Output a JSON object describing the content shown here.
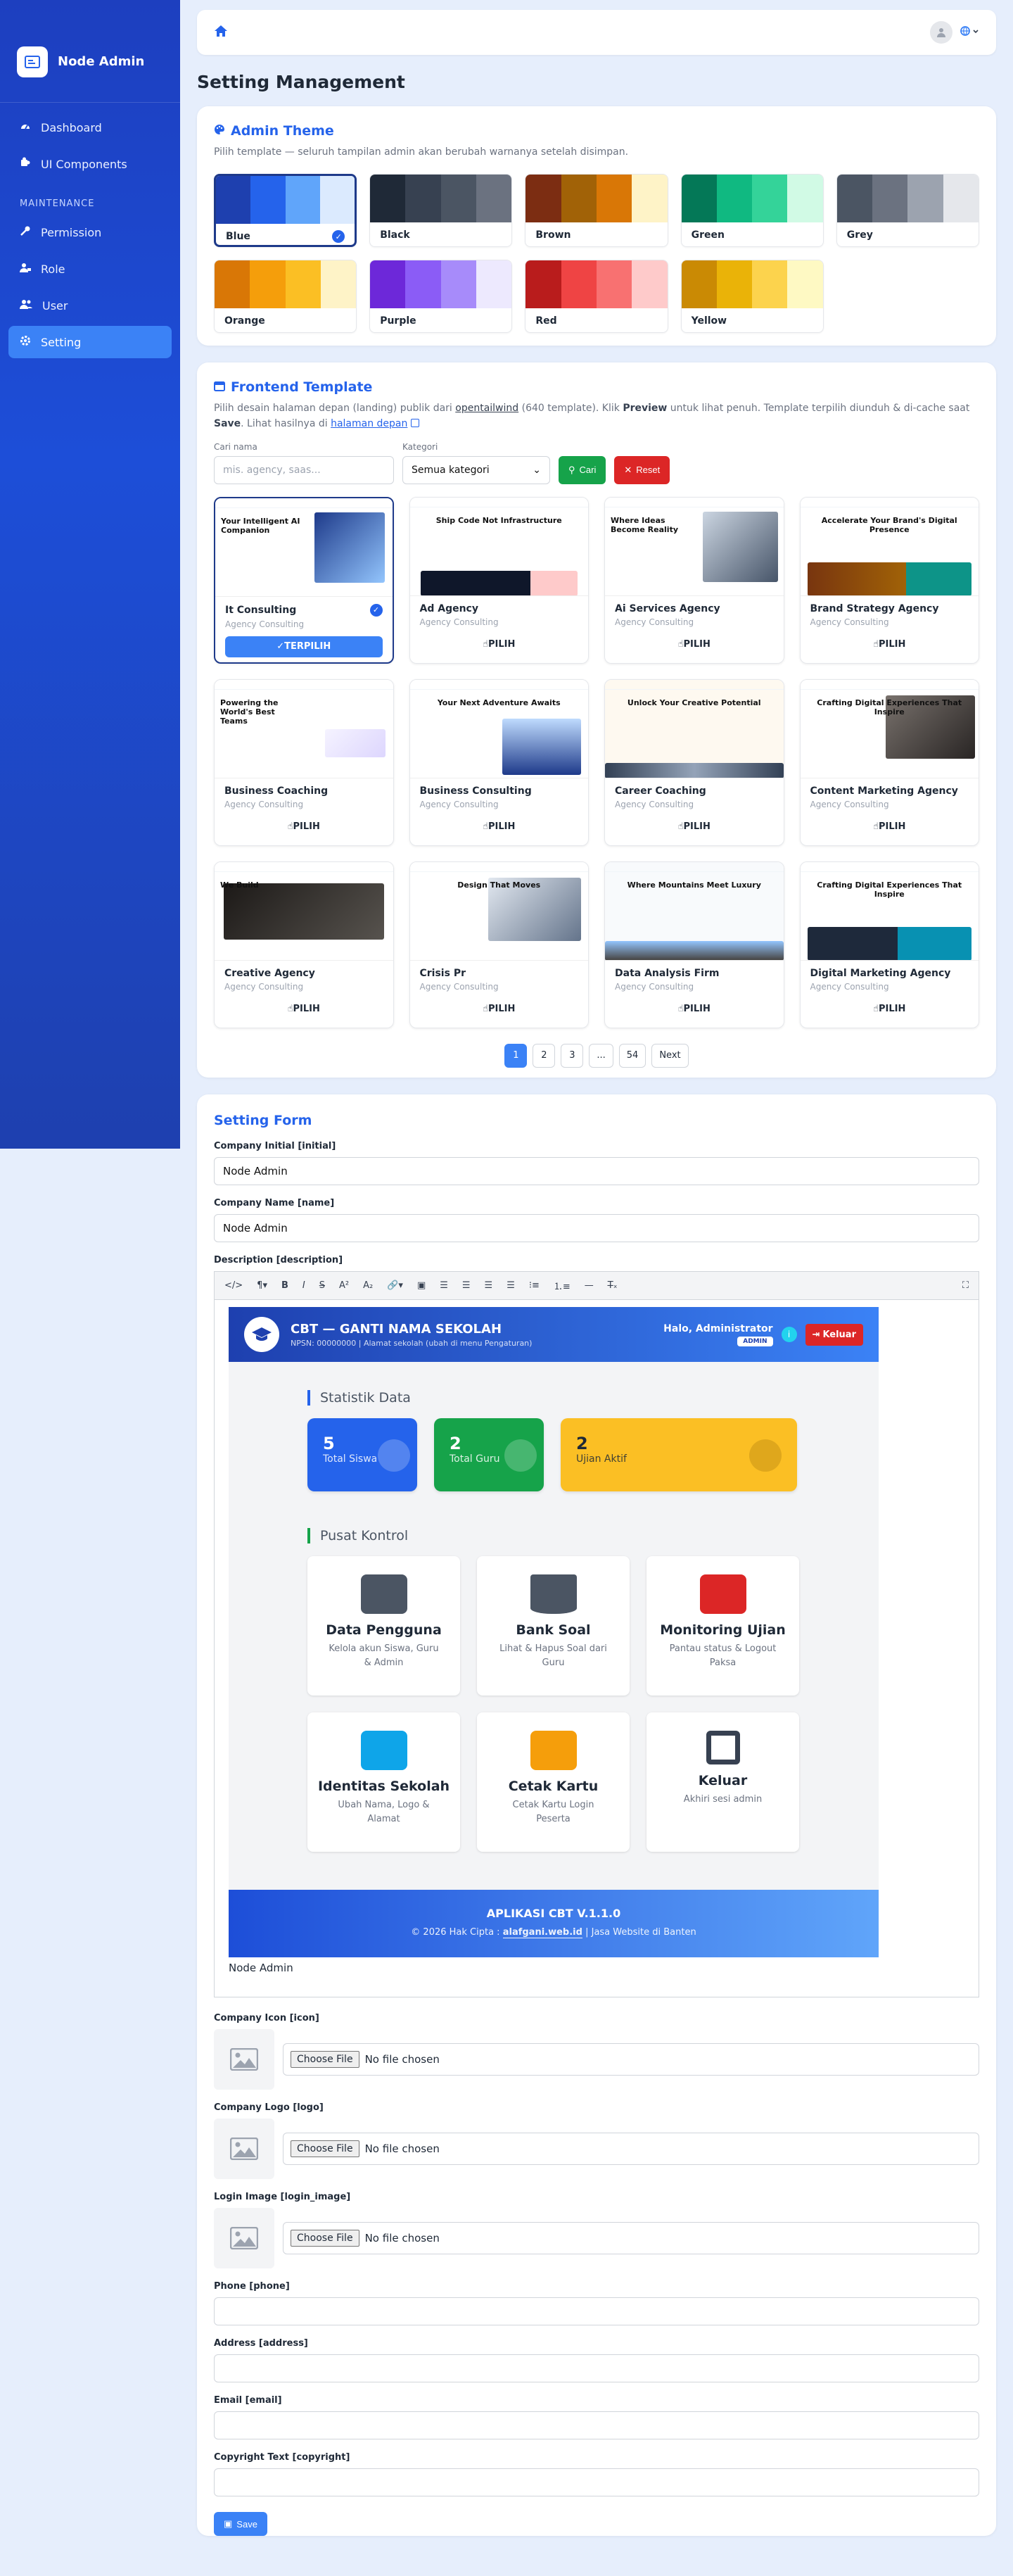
{
  "sidebar": {
    "brand": "Node Admin",
    "items": [
      {
        "label": "Dashboard",
        "icon": "gauge-icon"
      },
      {
        "label": "UI Components",
        "icon": "puzzle-icon"
      }
    ],
    "section_heading": "MAINTENANCE",
    "maintenance_items": [
      {
        "label": "Permission",
        "icon": "key-icon"
      },
      {
        "label": "Role",
        "icon": "user-tag-icon"
      },
      {
        "label": "User",
        "icon": "users-icon"
      },
      {
        "label": "Setting",
        "icon": "gear-icon",
        "active": true
      }
    ]
  },
  "page_title": "Setting Management",
  "theme_section": {
    "title": "Admin Theme",
    "subtitle": "Pilih template — seluruh tampilan admin akan berubah warnanya setelah disimpan.",
    "themes": [
      {
        "name": "Blue",
        "colors": [
          "#1e40af",
          "#2563eb",
          "#60a5fa",
          "#dbeafe"
        ],
        "selected": true
      },
      {
        "name": "Black",
        "colors": [
          "#1f2937",
          "#374151",
          "#4b5563",
          "#6b7280"
        ]
      },
      {
        "name": "Brown",
        "colors": [
          "#7c2d12",
          "#a16207",
          "#d97706",
          "#fef3c7"
        ]
      },
      {
        "name": "Green",
        "colors": [
          "#047857",
          "#10b981",
          "#34d399",
          "#d1fae5"
        ]
      },
      {
        "name": "Grey",
        "colors": [
          "#4b5563",
          "#6b7280",
          "#9ca3af",
          "#e5e7eb"
        ]
      },
      {
        "name": "Orange",
        "colors": [
          "#d97706",
          "#f59e0b",
          "#fbbf24",
          "#fef3c7"
        ]
      },
      {
        "name": "Purple",
        "colors": [
          "#6d28d9",
          "#8b5cf6",
          "#a78bfa",
          "#ede9fe"
        ]
      },
      {
        "name": "Red",
        "colors": [
          "#b91c1c",
          "#ef4444",
          "#f87171",
          "#fecaca"
        ]
      },
      {
        "name": "Yellow",
        "colors": [
          "#ca8a04",
          "#eab308",
          "#fcd34d",
          "#fef9c3"
        ]
      }
    ]
  },
  "frontend_section": {
    "title": "Frontend Template",
    "desc_1": "Pilih desain halaman depan (landing) publik dari ",
    "desc_link": "opentailwind",
    "desc_2": " (640 template). Klik ",
    "desc_preview": "Preview",
    "desc_3": " untuk lihat penuh. Template terpilih diunduh & di-cache saat ",
    "desc_save": "Save",
    "desc_4": ". Lihat hasilnya di ",
    "desc_link2": "halaman depan",
    "search_label": "Cari nama",
    "search_placeholder": "mis. agency, saas...",
    "category_label": "Kategori",
    "category_value": "Semua kategori",
    "search_button": "Cari",
    "reset_button": "Reset",
    "pick_label": "PILIH",
    "picked_label": "TERPILIH",
    "templates": [
      {
        "name": "It Consulting",
        "category": "Agency Consulting",
        "selected": true,
        "headline": "Your Intelligent AI Companion"
      },
      {
        "name": "Ad Agency",
        "category": "Agency Consulting",
        "headline": "Ship Code Not Infrastructure"
      },
      {
        "name": "Ai Services Agency",
        "category": "Agency Consulting",
        "headline": "Where Ideas Become Reality"
      },
      {
        "name": "Brand Strategy Agency",
        "category": "Agency Consulting",
        "headline": "Accelerate Your Brand's Digital Presence"
      },
      {
        "name": "Business Coaching",
        "category": "Agency Consulting",
        "headline": "Powering the World's Best Teams"
      },
      {
        "name": "Business Consulting",
        "category": "Agency Consulting",
        "headline": "Your Next Adventure Awaits"
      },
      {
        "name": "Career Coaching",
        "category": "Agency Consulting",
        "headline": "Unlock Your Creative Potential"
      },
      {
        "name": "Content Marketing Agency",
        "category": "Agency Consulting",
        "headline": "Crafting Digital Experiences That Inspire"
      },
      {
        "name": "Creative Agency",
        "category": "Agency Consulting",
        "headline": "We Build"
      },
      {
        "name": "Crisis Pr",
        "category": "Agency Consulting",
        "headline": "Design That Moves"
      },
      {
        "name": "Data Analysis Firm",
        "category": "Agency Consulting",
        "headline": "Where Mountains Meet Luxury"
      },
      {
        "name": "Digital Marketing Agency",
        "category": "Agency Consulting",
        "headline": "Crafting Digital Experiences That Inspire"
      }
    ],
    "pagination": {
      "pages": [
        "1",
        "2",
        "3",
        "...",
        "54"
      ],
      "current": "1",
      "next": "Next"
    }
  },
  "setting_form": {
    "title": "Setting Form",
    "company_initial_label": "Company Initial [initial]",
    "company_initial_value": "Node Admin",
    "company_name_label": "Company Name [name]",
    "company_name_value": "Node Admin",
    "description_label": "Description [description]",
    "editor_text_below": "Node Admin",
    "icon_label": "Company Icon [icon]",
    "logo_label": "Company Logo [logo]",
    "login_image_label": "Login Image [login_image]",
    "choose_file": "Choose File",
    "no_file": "No file chosen",
    "phone_label": "Phone [phone]",
    "address_label": "Address [address]",
    "email_label": "Email [email]",
    "copyright_label": "Copyright Text [copyright]",
    "save_button": "Save"
  },
  "cbt_preview": {
    "title": "CBT — GANTI NAMA SEKOLAH",
    "subtitle": "NPSN: 00000000 | Alamat sekolah (ubah di menu Pengaturan)",
    "greeting": "Halo, Administrator",
    "role_badge": "ADMIN",
    "logout": "Keluar",
    "stats_heading": "Statistik Data",
    "stats": [
      {
        "value": "5",
        "label": "Total Siswa",
        "color": "#2563eb"
      },
      {
        "value": "2",
        "label": "Total Guru",
        "color": "#16a34a"
      },
      {
        "value": "2",
        "label": "Ujian Aktif",
        "color": "#fbbf24"
      }
    ],
    "control_heading": "Pusat Kontrol",
    "controls": [
      {
        "title": "Data Pengguna",
        "desc": "Kelola akun Siswa, Guru & Admin",
        "icon": "users-cog-icon"
      },
      {
        "title": "Bank Soal",
        "desc": "Lihat & Hapus Soal dari Guru",
        "icon": "book-icon"
      },
      {
        "title": "Monitoring Ujian",
        "desc": "Pantau status & Logout Paksa",
        "icon": "monitor-icon"
      },
      {
        "title": "Identitas Sekolah",
        "desc": "Ubah Nama, Logo & Alamat",
        "icon": "school-icon"
      },
      {
        "title": "Cetak Kartu",
        "desc": "Cetak Kartu Login Peserta",
        "icon": "id-card-icon"
      },
      {
        "title": "Keluar",
        "desc": "Akhiri sesi admin",
        "icon": "sign-out-icon"
      }
    ],
    "footer_title": "APLIKASI CBT V.1.1.0",
    "footer_copy": "© 2026 Hak Cipta :",
    "footer_link": "alafgani.web.id",
    "footer_sep": "|",
    "footer_tail": "Jasa Website di Banten"
  }
}
